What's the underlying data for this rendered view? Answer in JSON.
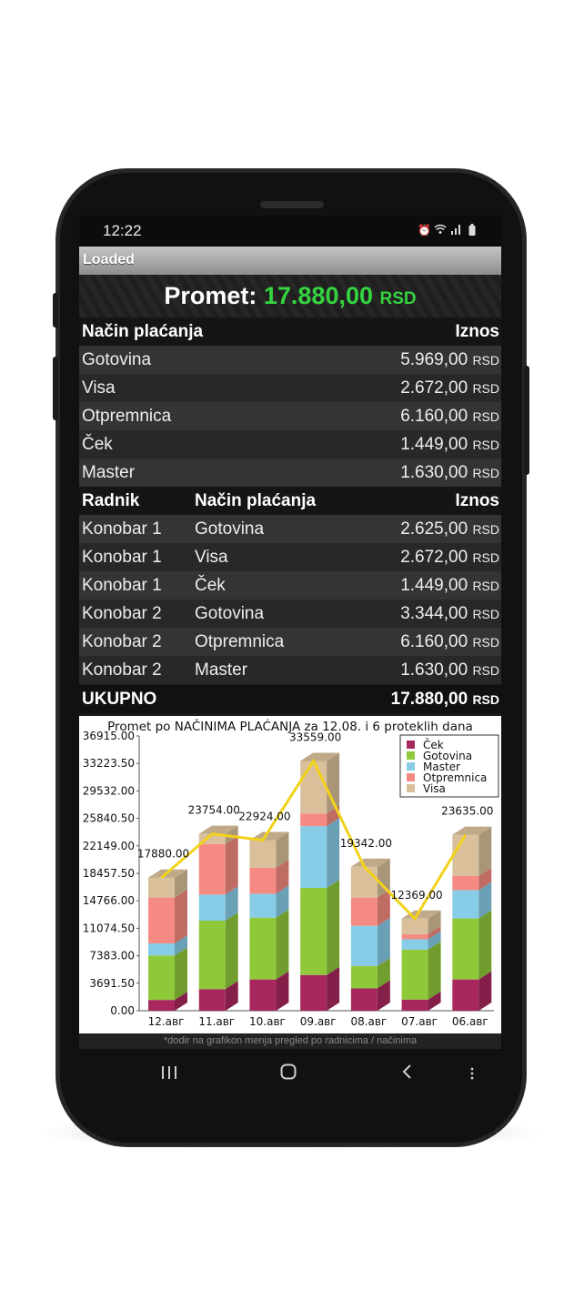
{
  "status_bar": {
    "time": "12:22",
    "icons": [
      "alarm-icon",
      "wifi-icon",
      "signal-icon",
      "battery-icon"
    ]
  },
  "app": {
    "title": "Loaded"
  },
  "summary": {
    "label": "Promet:",
    "value": "17.880,00",
    "currency": "RSD"
  },
  "payment_table": {
    "headers": [
      "Način plaćanja",
      "Iznos"
    ],
    "rows": [
      {
        "method": "Gotovina",
        "amount": "5.969,00",
        "currency": "RSD"
      },
      {
        "method": "Visa",
        "amount": "2.672,00",
        "currency": "RSD"
      },
      {
        "method": "Otpremnica",
        "amount": "6.160,00",
        "currency": "RSD"
      },
      {
        "method": "Ček",
        "amount": "1.449,00",
        "currency": "RSD"
      },
      {
        "method": "Master",
        "amount": "1.630,00",
        "currency": "RSD"
      }
    ]
  },
  "worker_table": {
    "headers": [
      "Radnik",
      "Način plaćanja",
      "Iznos"
    ],
    "rows": [
      {
        "worker": "Konobar 1",
        "method": "Gotovina",
        "amount": "2.625,00",
        "currency": "RSD"
      },
      {
        "worker": "Konobar 1",
        "method": "Visa",
        "amount": "2.672,00",
        "currency": "RSD"
      },
      {
        "worker": "Konobar 1",
        "method": "Ček",
        "amount": "1.449,00",
        "currency": "RSD"
      },
      {
        "worker": "Konobar 2",
        "method": "Gotovina",
        "amount": "3.344,00",
        "currency": "RSD"
      },
      {
        "worker": "Konobar 2",
        "method": "Otpremnica",
        "amount": "6.160,00",
        "currency": "RSD"
      },
      {
        "worker": "Konobar 2",
        "method": "Master",
        "amount": "1.630,00",
        "currency": "RSD"
      }
    ],
    "total": {
      "label": "UKUPNO",
      "amount": "17.880,00",
      "currency": "RSD"
    }
  },
  "chart_data": {
    "type": "bar",
    "stacked": true,
    "title": "Promet po NAČINIMA PLAĆANJA za 12.08. i 6 proteklih dana",
    "categories": [
      "12.авг",
      "11.авг",
      "10.авг",
      "09.авг",
      "08.авг",
      "07.авг",
      "06.авг"
    ],
    "series": [
      {
        "name": "Ček",
        "color": "#a8285e",
        "values": [
          1449,
          2900,
          4200,
          4800,
          3000,
          1500,
          4200
        ]
      },
      {
        "name": "Gotovina",
        "color": "#8fc93a",
        "values": [
          5969,
          9200,
          8300,
          11700,
          3000,
          6700,
          8200
        ]
      },
      {
        "name": "Master",
        "color": "#87cde8",
        "values": [
          1630,
          3500,
          3200,
          8300,
          5400,
          1400,
          3800
        ]
      },
      {
        "name": "Otpremnica",
        "color": "#f58a82",
        "values": [
          6160,
          6800,
          3500,
          1700,
          3800,
          700,
          1900
        ]
      },
      {
        "name": "Visa",
        "color": "#d9c09a",
        "values": [
          2672,
          1354,
          3724,
          7059,
          4142,
          2069,
          5535
        ]
      }
    ],
    "totals": [
      17880,
      23754,
      22924,
      33559,
      19342,
      12369,
      23635
    ],
    "total_labels": [
      "17880.00",
      "23754.00",
      "22924.00",
      "33559.00",
      "19342.00",
      "12369.00",
      "23635.00"
    ],
    "total_line_color": "#f2d21a",
    "yticks": [
      "0.00",
      "3691.50",
      "7383.00",
      "11074.50",
      "14766.00",
      "18457.50",
      "22149.00",
      "25840.50",
      "29532.00",
      "33223.50",
      "36915.00"
    ],
    "ylim": [
      0,
      36915
    ],
    "legend_position": "top-right",
    "grid": false
  },
  "hint": "*dodir na grafikon menja pregled po radnicima / načinima",
  "nav_bar": {
    "icons": [
      "recent-apps-icon",
      "home-icon",
      "back-icon",
      "menu-dots-icon"
    ]
  }
}
